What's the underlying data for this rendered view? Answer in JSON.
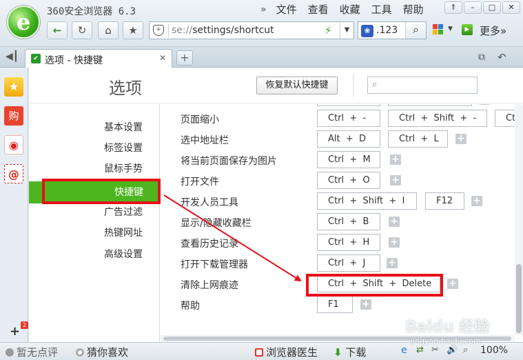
{
  "window": {
    "title": "360安全浏览器 6.3",
    "menu": [
      "文件",
      "查看",
      "收藏",
      "工具",
      "帮助"
    ],
    "menu_chevron": "»",
    "controls": [
      "⇑",
      "–",
      "□",
      "✕"
    ]
  },
  "toolbar": {
    "address_prefix": "se://",
    "address_path": "settings/shortcut",
    "search_value": ".123",
    "more_label": "更多»"
  },
  "tab": {
    "title": "选项 - 快捷键",
    "close": "✕",
    "new": "+"
  },
  "sidebar": {
    "icons": [
      "favorites-star-icon",
      "shopping-icon",
      "weibo-icon",
      "mail-icon"
    ],
    "shopping_glyph": "购",
    "mail_glyph": "@",
    "add": "+",
    "badge": "2"
  },
  "page": {
    "title": "选项",
    "restore_button": "恢复默认快捷键",
    "search_placeholder": ""
  },
  "nav": {
    "items": [
      "基本设置",
      "标签设置",
      "鼠标手势",
      "快捷键",
      "广告过滤",
      "热键网址",
      "高级设置"
    ],
    "active_index": 3
  },
  "shortcuts": [
    {
      "label": "",
      "keys": [
        "",
        "",
        ""
      ]
    },
    {
      "label": "页面缩小",
      "keys": [
        "Ctrl  +  -",
        "Ctrl  +  Shift  +  -",
        "Ct"
      ]
    },
    {
      "label": "选中地址栏",
      "keys": [
        "Alt  +  D",
        "Ctrl  +  L"
      ]
    },
    {
      "label": "将当前页面保存为图片",
      "keys": [
        "Ctrl  +  M"
      ]
    },
    {
      "label": "打开文件",
      "keys": [
        "Ctrl  +  O"
      ]
    },
    {
      "label": "开发人员工具",
      "keys": [
        "Ctrl  +  Shift  +  I",
        "F12"
      ]
    },
    {
      "label": "显示/隐藏收藏栏",
      "keys": [
        "Ctrl  +  B"
      ]
    },
    {
      "label": "查看历史记录",
      "keys": [
        "Ctrl  +  H"
      ]
    },
    {
      "label": "打开下载管理器",
      "keys": [
        "Ctrl  +  J"
      ]
    },
    {
      "label": "清除上网痕迹",
      "keys": [
        "Ctrl  +  Shift  +  Delete"
      ]
    },
    {
      "label": "帮助",
      "keys": [
        "F1"
      ]
    }
  ],
  "statusbar": {
    "no_rating": "暂无点评",
    "guess": "猜你喜欢",
    "doctor": "浏览器医生",
    "download": "下载",
    "zoom": "100%"
  },
  "watermark": {
    "brand": "Baidu 经验",
    "url": "jingyan.baidu.com"
  },
  "colors": {
    "accent_green": "#4db51f",
    "highlight_red": "#e8101a"
  }
}
